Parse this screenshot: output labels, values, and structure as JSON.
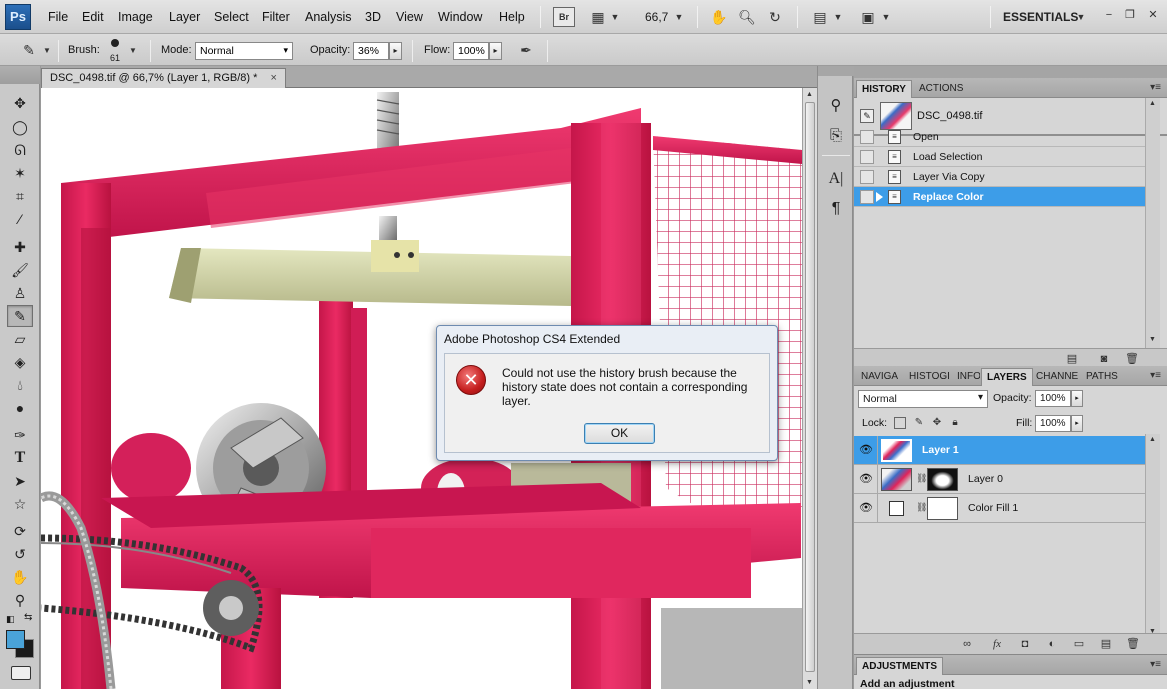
{
  "menubar": {
    "logo": "Ps",
    "items": [
      "File",
      "Edit",
      "Image",
      "Layer",
      "Select",
      "Filter",
      "Analysis",
      "3D",
      "View",
      "Window",
      "Help"
    ],
    "bridge_label": "Br",
    "zoom": "66,7",
    "workspace": "ESSENTIALS"
  },
  "options": {
    "brush_label": "Brush:",
    "brush_size": "61",
    "mode_label": "Mode:",
    "mode_value": "Normal",
    "opacity_label": "Opacity:",
    "opacity_value": "36%",
    "flow_label": "Flow:",
    "flow_value": "100%"
  },
  "document": {
    "tab_title": "DSC_0498.tif @ 66,7% (Layer 1, RGB/8) *",
    "close_glyph": "×"
  },
  "dialog": {
    "title": "Adobe Photoshop CS4 Extended",
    "message": "Could not use the history brush because the history state does not contain a corresponding layer.",
    "ok_label": "OK",
    "icon_glyph": "✕"
  },
  "history_panel": {
    "tabs": [
      "HISTORY",
      "ACTIONS"
    ],
    "snapshot": "DSC_0498.tif",
    "states": [
      "Open",
      "Load Selection",
      "Layer Via Copy",
      "Replace Color"
    ],
    "selected_index": 3
  },
  "layers_panel": {
    "tabs": [
      "NAVIGA",
      "HISTOGI",
      "INFO",
      "LAYERS",
      "CHANNE",
      "PATHS"
    ],
    "active_tab": "LAYERS",
    "blend_mode": "Normal",
    "opacity_label": "Opacity:",
    "opacity_value": "100%",
    "lock_label": "Lock:",
    "fill_label": "Fill:",
    "fill_value": "100%",
    "layers": [
      "Layer 1",
      "Layer 0",
      "Color Fill 1"
    ],
    "selected_index": 0
  },
  "adjustments_panel": {
    "tab": "ADJUSTMENTS",
    "hint": "Add an adjustment"
  },
  "colors": {
    "foreground": "#4aa3d8",
    "background": "#1a1a1a",
    "selection": "#3d9de8",
    "machine_red": "#e31d5b"
  }
}
